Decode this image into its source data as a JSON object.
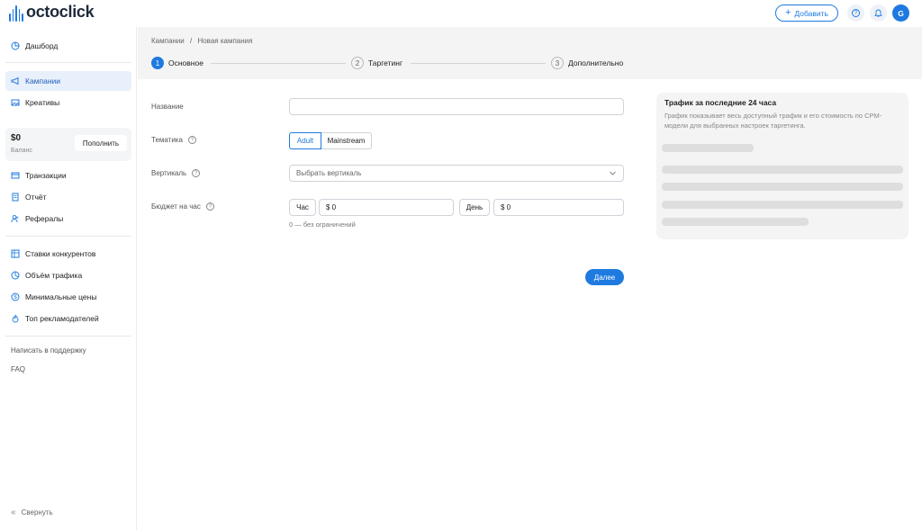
{
  "brand": {
    "name": "octoclick"
  },
  "topbar": {
    "add_label": "Добавить",
    "avatar_letter": "G"
  },
  "sidebar": {
    "items": [
      {
        "label": "Дашборд",
        "icon": "pie-chart-icon"
      },
      {
        "label": "Кампании",
        "icon": "megaphone-icon",
        "active": true
      },
      {
        "label": "Креативы",
        "icon": "image-icon"
      },
      {
        "label": "Транзакции",
        "icon": "card-icon"
      },
      {
        "label": "Отчёт",
        "icon": "report-icon"
      },
      {
        "label": "Рефералы",
        "icon": "referrals-icon"
      },
      {
        "label": "Ставки конкурентов",
        "icon": "table-icon"
      },
      {
        "label": "Объём трафика",
        "icon": "pie-icon"
      },
      {
        "label": "Минимальные цены",
        "icon": "dollar-icon"
      },
      {
        "label": "Топ рекламодателей",
        "icon": "flame-icon"
      }
    ],
    "balance": {
      "amount": "$0",
      "label": "Баланс",
      "topup_label": "Пополнить"
    },
    "support_label": "Написать в поддержку",
    "faq_label": "FAQ",
    "collapse_label": "Свернуть"
  },
  "breadcrumb": {
    "parent": "Кампании",
    "separator": "/",
    "current": "Новая кампания"
  },
  "steps": [
    {
      "num": "1",
      "label": "Основное",
      "active": true
    },
    {
      "num": "2",
      "label": "Таргетинг"
    },
    {
      "num": "3",
      "label": "Дополнительно"
    }
  ],
  "form": {
    "name_label": "Название",
    "name_value": "",
    "theme_label": "Тематика",
    "theme_options": [
      "Adult",
      "Mainstream"
    ],
    "theme_selected": "Adult",
    "vertical_label": "Вертикаль",
    "vertical_placeholder": "Выбрать вертикаль",
    "budget_label": "Бюджет на час",
    "hour_label": "Час",
    "hour_value": "$ 0",
    "day_label": "День",
    "day_value": "$ 0",
    "budget_hint": "0 — без ограничений",
    "next_label": "Далее"
  },
  "traffic_panel": {
    "title": "Трафик за последние 24 часа",
    "description": "График показывает весь доступный трафик и его стоимость по CPM-модели для выбранных настроек таргетинга."
  },
  "colors": {
    "accent": "#1f7ae0",
    "active_bg": "#e8f0fc",
    "panel_bg": "#f4f4f4"
  }
}
